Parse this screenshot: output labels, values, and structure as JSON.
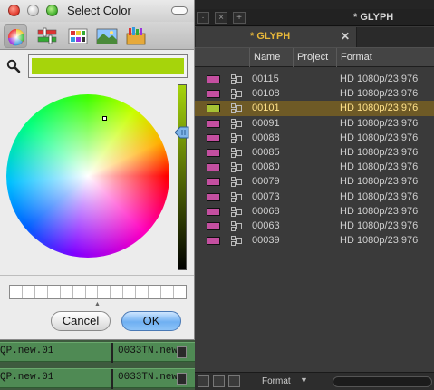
{
  "color_picker": {
    "title": "Select Color",
    "selected_color": "#a6d40b",
    "cancel_label": "Cancel",
    "ok_label": "OK",
    "modes": [
      "color-wheel-icon",
      "color-sliders-icon",
      "color-palettes-icon",
      "image-palettes-icon",
      "crayons-icon"
    ],
    "active_mode": "color-wheel-icon",
    "swatch_tray_cells": 14
  },
  "bin": {
    "window_title": "* GLYPH",
    "tab_label": "* GLYPH",
    "columns": [
      "Name",
      "Project",
      "Format"
    ],
    "rows": [
      {
        "name": "00115",
        "format": "HD 1080p/23.976",
        "color": "#c44fa0",
        "selected": false
      },
      {
        "name": "00108",
        "format": "HD 1080p/23.976",
        "color": "#c44fa0",
        "selected": false
      },
      {
        "name": "00101",
        "format": "HD 1080p/23.976",
        "color": "#a6c234",
        "selected": true
      },
      {
        "name": "00091",
        "format": "HD 1080p/23.976",
        "color": "#c44fa0",
        "selected": false
      },
      {
        "name": "00088",
        "format": "HD 1080p/23.976",
        "color": "#c44fa0",
        "selected": false
      },
      {
        "name": "00085",
        "format": "HD 1080p/23.976",
        "color": "#c44fa0",
        "selected": false
      },
      {
        "name": "00080",
        "format": "HD 1080p/23.976",
        "color": "#c44fa0",
        "selected": false
      },
      {
        "name": "00079",
        "format": "HD 1080p/23.976",
        "color": "#c44fa0",
        "selected": false
      },
      {
        "name": "00073",
        "format": "HD 1080p/23.976",
        "color": "#c44fa0",
        "selected": false
      },
      {
        "name": "00068",
        "format": "HD 1080p/23.976",
        "color": "#c44fa0",
        "selected": false
      },
      {
        "name": "00063",
        "format": "HD 1080p/23.976",
        "color": "#c44fa0",
        "selected": false
      },
      {
        "name": "00039",
        "format": "HD 1080p/23.976",
        "color": "#c44fa0",
        "selected": false
      }
    ],
    "bottom_view_label": "Format"
  },
  "timeline": {
    "rows": [
      {
        "left": "QP.new.01",
        "right": "0033TN.new"
      },
      {
        "left": "QP.new.01",
        "right": "0033TN.new"
      }
    ]
  }
}
